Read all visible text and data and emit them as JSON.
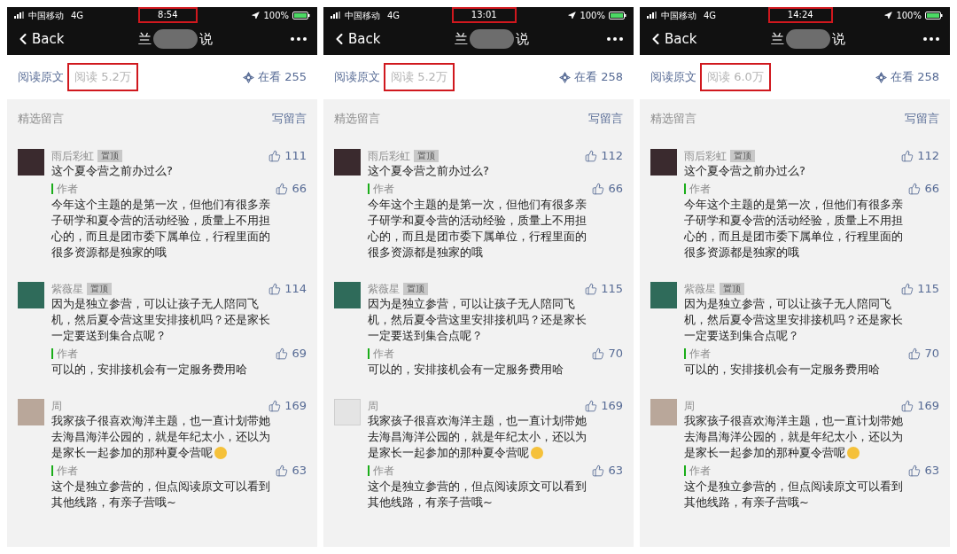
{
  "panels": [
    {
      "status_bar": {
        "carrier": "中国移动",
        "network": "4G",
        "time": "8:54",
        "time_highlighted": true,
        "battery": "100%"
      },
      "nav": {
        "back": "Back",
        "title_start": "兰",
        "title_end": "说"
      },
      "stats": {
        "read_original": "阅读原文",
        "reads": "阅读 5.2万",
        "reads_highlighted": true,
        "watching": "在看 255"
      },
      "comments_header": {
        "title": "精选留言",
        "write": "写留言"
      },
      "comments": [
        {
          "kind": "photo",
          "name": "雨后彩虹",
          "badge": "置顶",
          "likes": "111",
          "text": "这个夏令营之前办过么?",
          "emoji": false,
          "reply": {
            "label": "作者",
            "likes": "66",
            "text": "今年这个主题的是第一次，但他们有很多亲子研学和夏令营的活动经验，质量上不用担心的，而且是团市委下属单位，行程里面的很多资源都是独家的哦"
          }
        },
        {
          "kind": "photo",
          "name": "紫薇星",
          "badge": "置顶",
          "likes": "114",
          "text": "因为是独立参营，可以让孩子无人陪同飞机，然后夏令营这里安排接机吗？还是家长一定要送到集合点呢？",
          "emoji": false,
          "reply": {
            "label": "作者",
            "likes": "69",
            "text": "可以的，安排接机会有一定服务费用哈"
          }
        },
        {
          "kind": "photo",
          "name": "周",
          "likes": "169",
          "text": "我家孩子很喜欢海洋主题，也一直计划带她去海昌海洋公园的，就是年纪太小，还以为是家长一起参加的那种夏令营呢",
          "emoji": true,
          "reply": {
            "label": "作者",
            "likes": "63",
            "text": "这个是独立参营的，但点阅读原文可以看到其他线路，有亲子营哦~"
          }
        }
      ]
    },
    {
      "status_bar": {
        "carrier": "中国移动",
        "network": "4G",
        "time": "13:01",
        "time_highlighted": true,
        "battery": "100%"
      },
      "nav": {
        "back": "Back",
        "title_start": "兰",
        "title_end": "说"
      },
      "stats": {
        "read_original": "阅读原文",
        "reads": "阅读 5.2万",
        "reads_highlighted": true,
        "watching": "在看 258"
      },
      "comments_header": {
        "title": "精选留言",
        "write": "写留言"
      },
      "comments": [
        {
          "kind": "photo",
          "name": "雨后彩虹",
          "badge": "置顶",
          "likes": "112",
          "text": "这个夏令营之前办过么?",
          "emoji": false,
          "reply": {
            "label": "作者",
            "likes": "66",
            "text": "今年这个主题的是第一次，但他们有很多亲子研学和夏令营的活动经验，质量上不用担心的，而且是团市委下属单位，行程里面的很多资源都是独家的哦"
          }
        },
        {
          "kind": "photo",
          "name": "紫薇星",
          "badge": "置顶",
          "likes": "115",
          "text": "因为是独立参营，可以让孩子无人陪同飞机，然后夏令营这里安排接机吗？还是家长一定要送到集合点呢？",
          "emoji": false,
          "reply": {
            "label": "作者",
            "likes": "70",
            "text": "可以的，安排接机会有一定服务费用哈"
          }
        },
        {
          "kind": "broken",
          "name": "周",
          "likes": "169",
          "text": "我家孩子很喜欢海洋主题，也一直计划带她去海昌海洋公园的，就是年纪太小，还以为是家长一起参加的那种夏令营呢",
          "emoji": true,
          "reply": {
            "label": "作者",
            "likes": "63",
            "text": "这个是独立参营的，但点阅读原文可以看到其他线路，有亲子营哦~"
          }
        }
      ]
    },
    {
      "status_bar": {
        "carrier": "中国移动",
        "network": "4G",
        "time": "14:24",
        "time_highlighted": true,
        "battery": "100%"
      },
      "nav": {
        "back": "Back",
        "title_start": "兰",
        "title_end": "说"
      },
      "stats": {
        "read_original": "阅读原文",
        "reads": "阅读 6.0万",
        "reads_highlighted": true,
        "watching": "在看 258"
      },
      "comments_header": {
        "title": "精选留言",
        "write": "写留言"
      },
      "comments": [
        {
          "kind": "photo",
          "name": "雨后彩虹",
          "badge": "置顶",
          "likes": "112",
          "text": "这个夏令营之前办过么?",
          "emoji": false,
          "reply": {
            "label": "作者",
            "likes": "66",
            "text": "今年这个主题的是第一次，但他们有很多亲子研学和夏令营的活动经验，质量上不用担心的，而且是团市委下属单位，行程里面的很多资源都是独家的哦"
          }
        },
        {
          "kind": "photo",
          "name": "紫薇星",
          "badge": "置顶",
          "likes": "115",
          "text": "因为是独立参营，可以让孩子无人陪同飞机，然后夏令营这里安排接机吗？还是家长一定要送到集合点呢？",
          "emoji": false,
          "reply": {
            "label": "作者",
            "likes": "70",
            "text": "可以的，安排接机会有一定服务费用哈"
          }
        },
        {
          "kind": "photo",
          "name": "周",
          "likes": "169",
          "text": "我家孩子很喜欢海洋主题，也一直计划带她去海昌海洋公园的，就是年纪太小，还以为是家长一起参加的那种夏令营呢",
          "emoji": true,
          "reply": {
            "label": "作者",
            "likes": "63",
            "text": "这个是独立参营的，但点阅读原文可以看到其他线路，有亲子营哦~"
          }
        }
      ]
    }
  ]
}
